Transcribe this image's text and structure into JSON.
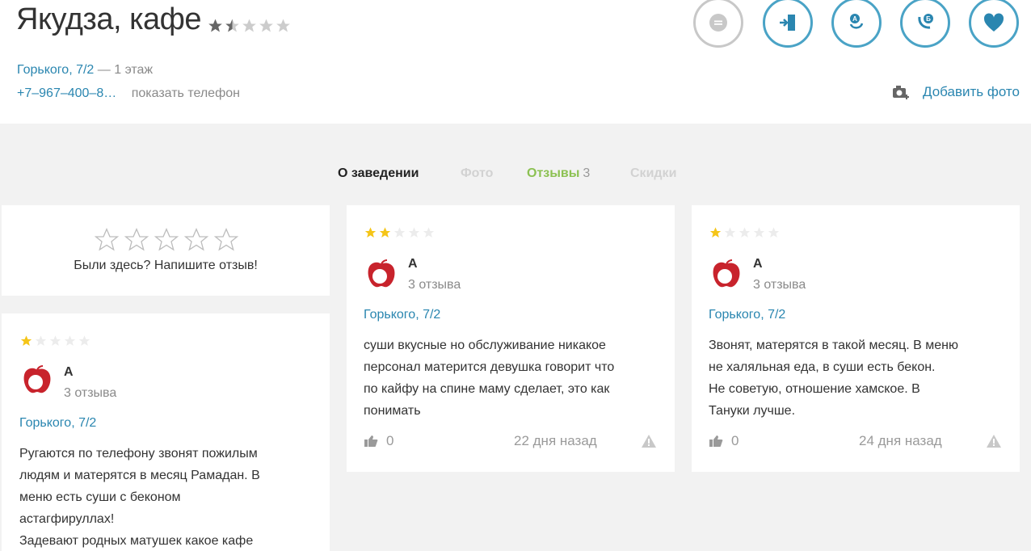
{
  "header": {
    "title": "Якудза, кафе",
    "rating_stars": 1.5,
    "address_link": "Горького, 7/2",
    "floor": "— 1 этаж",
    "phone": "+7–967–400–8…",
    "show_phone": "показать телефон",
    "add_photo": "Добавить фото",
    "actions": [
      "comment-icon",
      "enter-icon",
      "route-icon",
      "call-icon",
      "favorite-icon"
    ]
  },
  "tabs": {
    "about": "О заведении",
    "photo": "Фото",
    "reviews": "Отзывы",
    "reviews_count": "3",
    "discounts": "Скидки"
  },
  "write_review": {
    "text": "Были здесь? Напишите отзыв!"
  },
  "colors": {
    "accent_blue": "#2a86b0",
    "ring_blue": "#4aa3c6",
    "green": "#8cc152",
    "star_gold": "#f5c518",
    "avatar_red": "#c8232c"
  },
  "reviews": [
    {
      "stars": 1,
      "author": "А",
      "reviews_count": "3 отзыва",
      "place": "Горького, 7/2",
      "lines": [
        "Ругаются по телефону звонят пожилым",
        "людям и матерятся в месяц Рамадан. В",
        "меню есть суши с беконом",
        "астагфируллах!",
        "Задевают родных матушек какое кафе"
      ]
    },
    {
      "stars": 2,
      "author": "А",
      "reviews_count": "3 отзыва",
      "place": "Горького, 7/2",
      "lines": [
        "суши вкусные но обслуживание никакое",
        "персонал матерится девушка говорит что",
        "по кайфу на спине маму сделает, это как",
        "понимать"
      ],
      "likes": "0",
      "date": "22 дня назад"
    },
    {
      "stars": 1,
      "author": "А",
      "reviews_count": "3 отзыва",
      "place": "Горького, 7/2",
      "lines": [
        "Звонят, матерятся в такой месяц. В меню",
        "не халяльная еда, в суши есть бекон.",
        "Не советую, отношение хамское. В",
        "Тануки лучше."
      ],
      "likes": "0",
      "date": "24 дня назад"
    }
  ]
}
